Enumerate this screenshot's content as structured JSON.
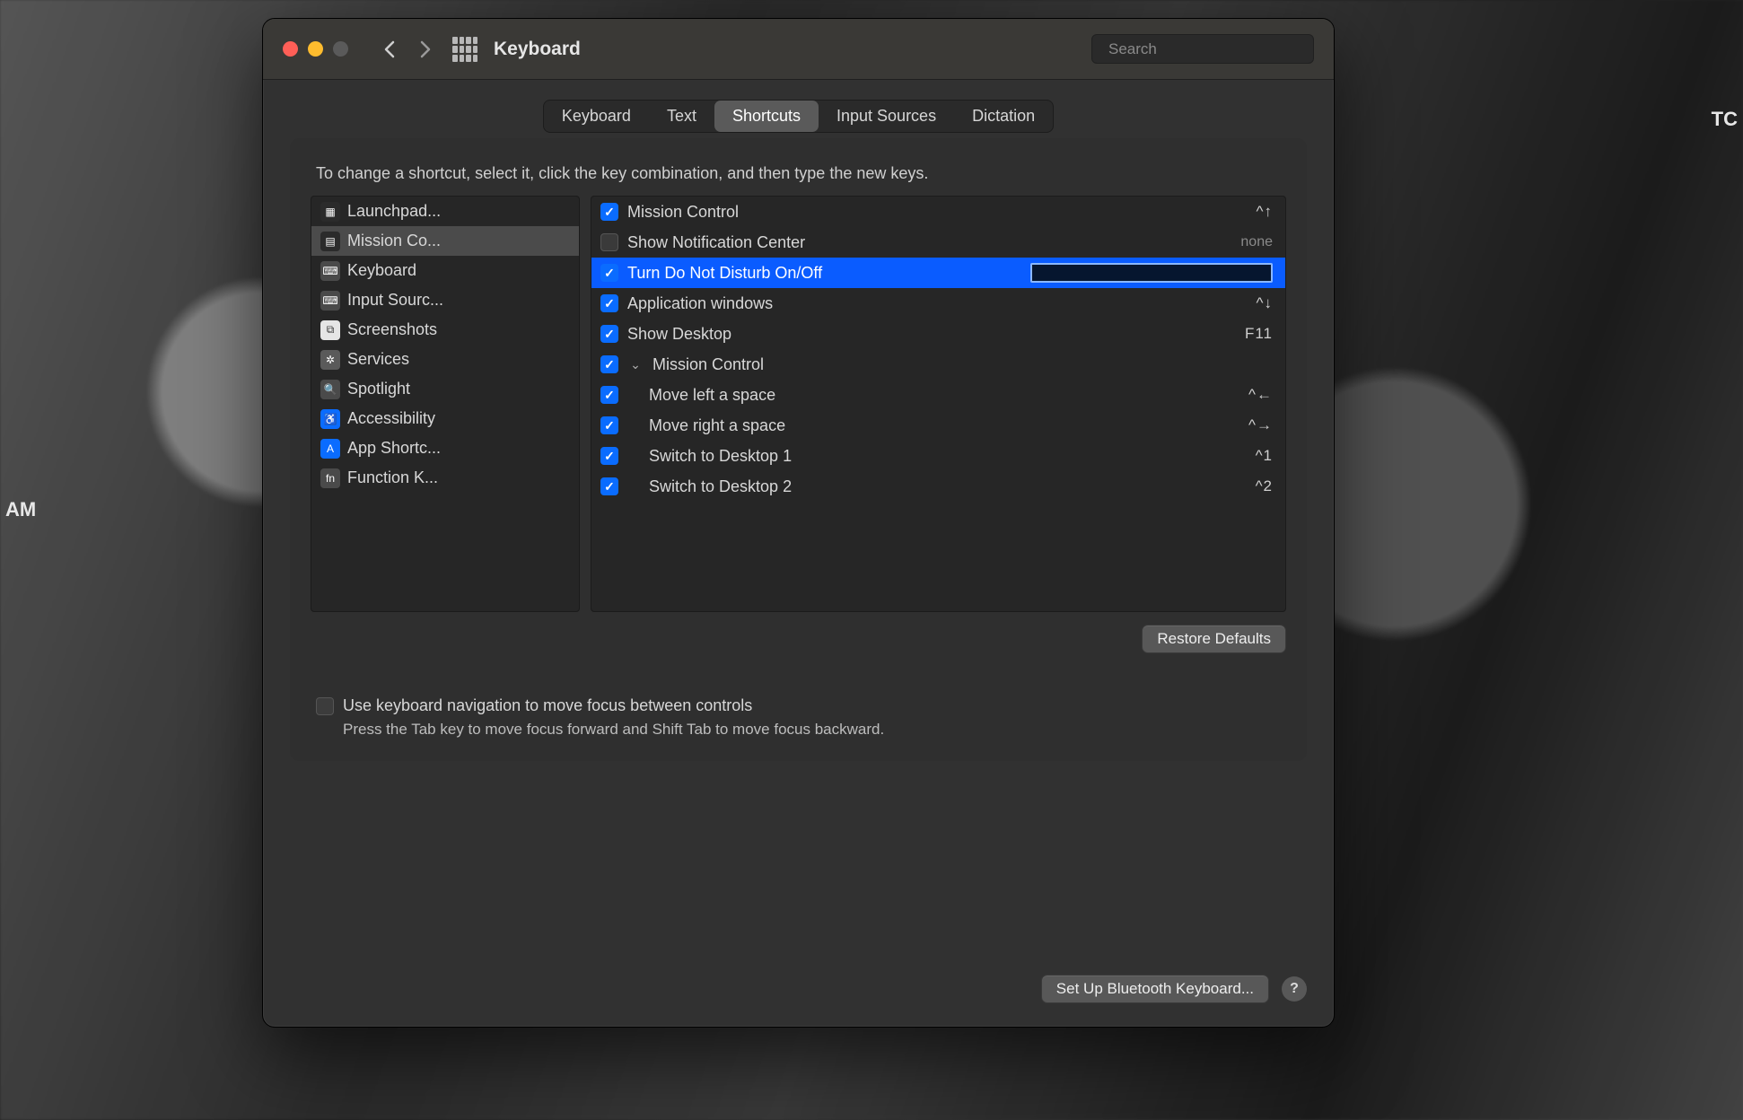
{
  "window": {
    "title": "Keyboard",
    "search_placeholder": "Search"
  },
  "tabs": [
    {
      "label": "Keyboard",
      "active": false
    },
    {
      "label": "Text",
      "active": false
    },
    {
      "label": "Shortcuts",
      "active": true
    },
    {
      "label": "Input Sources",
      "active": false
    },
    {
      "label": "Dictation",
      "active": false
    }
  ],
  "instructions": "To change a shortcut, select it, click the key combination, and then type the new keys.",
  "categories": [
    {
      "label": "Launchpad...",
      "icon": "launchpad-icon",
      "bg": "#2b2b2b"
    },
    {
      "label": "Mission Co...",
      "icon": "mission-control-icon",
      "bg": "#2b2b2b",
      "selected": true
    },
    {
      "label": "Keyboard",
      "icon": "keyboard-icon",
      "bg": "#4a4a4a"
    },
    {
      "label": "Input Sourc...",
      "icon": "input-sources-icon",
      "bg": "#4a4a4a"
    },
    {
      "label": "Screenshots",
      "icon": "screenshots-icon",
      "bg": "#e5e5e5"
    },
    {
      "label": "Services",
      "icon": "services-icon",
      "bg": "#5a5a5a"
    },
    {
      "label": "Spotlight",
      "icon": "spotlight-icon",
      "bg": "#4a4a4a"
    },
    {
      "label": "Accessibility",
      "icon": "accessibility-icon",
      "bg": "#0a6cff"
    },
    {
      "label": "App Shortc...",
      "icon": "app-shortcuts-icon",
      "bg": "#0a6cff"
    },
    {
      "label": "Function K...",
      "icon": "function-keys-icon",
      "bg": "#4a4a4a"
    }
  ],
  "shortcuts": [
    {
      "checked": true,
      "label": "Mission Control",
      "key": "^↑"
    },
    {
      "checked": false,
      "label": "Show Notification Center",
      "key": "none",
      "key_none": true
    },
    {
      "checked": true,
      "label": "Turn Do Not Disturb On/Off",
      "editing": true,
      "selected": true
    },
    {
      "checked": true,
      "label": "Application windows",
      "key": "^↓"
    },
    {
      "checked": true,
      "label": "Show Desktop",
      "key": "F11"
    },
    {
      "checked": true,
      "label": "Mission Control",
      "expandable": true
    },
    {
      "checked": true,
      "label": "Move left a space",
      "key": "^←",
      "indent": 1
    },
    {
      "checked": true,
      "label": "Move right a space",
      "key": "^→",
      "indent": 1
    },
    {
      "checked": true,
      "label": "Switch to Desktop 1",
      "key": "^1",
      "indent": 1
    },
    {
      "checked": true,
      "label": "Switch to Desktop 2",
      "key": "^2",
      "indent": 1
    }
  ],
  "restore_defaults": "Restore Defaults",
  "nav_checkbox_label": "Use keyboard navigation to move focus between controls",
  "nav_hint": "Press the Tab key to move focus forward and Shift Tab to move focus backward.",
  "bluetooth_btn": "Set Up Bluetooth Keyboard...",
  "desk": {
    "tc": "TC",
    "am": "AM"
  }
}
